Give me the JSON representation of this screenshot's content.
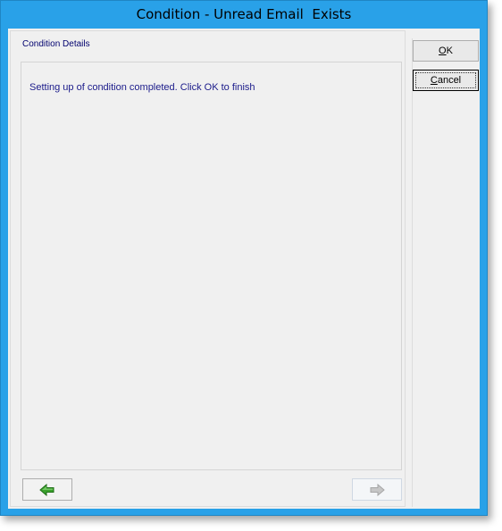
{
  "window": {
    "title": "Condition - Unread Email  Exists"
  },
  "group": {
    "title": "Condition Details",
    "message": "Setting up of condition completed. Click OK to finish"
  },
  "buttons": {
    "ok_mnemonic": "O",
    "ok_rest": "K",
    "cancel_mnemonic": "C",
    "cancel_rest": "ancel"
  },
  "icons": {
    "back": "arrow-left-icon",
    "next": "arrow-right-icon"
  },
  "colors": {
    "titlebar": "#29a1e8",
    "client": "#f0f0f0",
    "label_text": "#00006e",
    "back_arrow": "#3aa12c",
    "next_arrow_disabled": "#b8b8b8"
  }
}
